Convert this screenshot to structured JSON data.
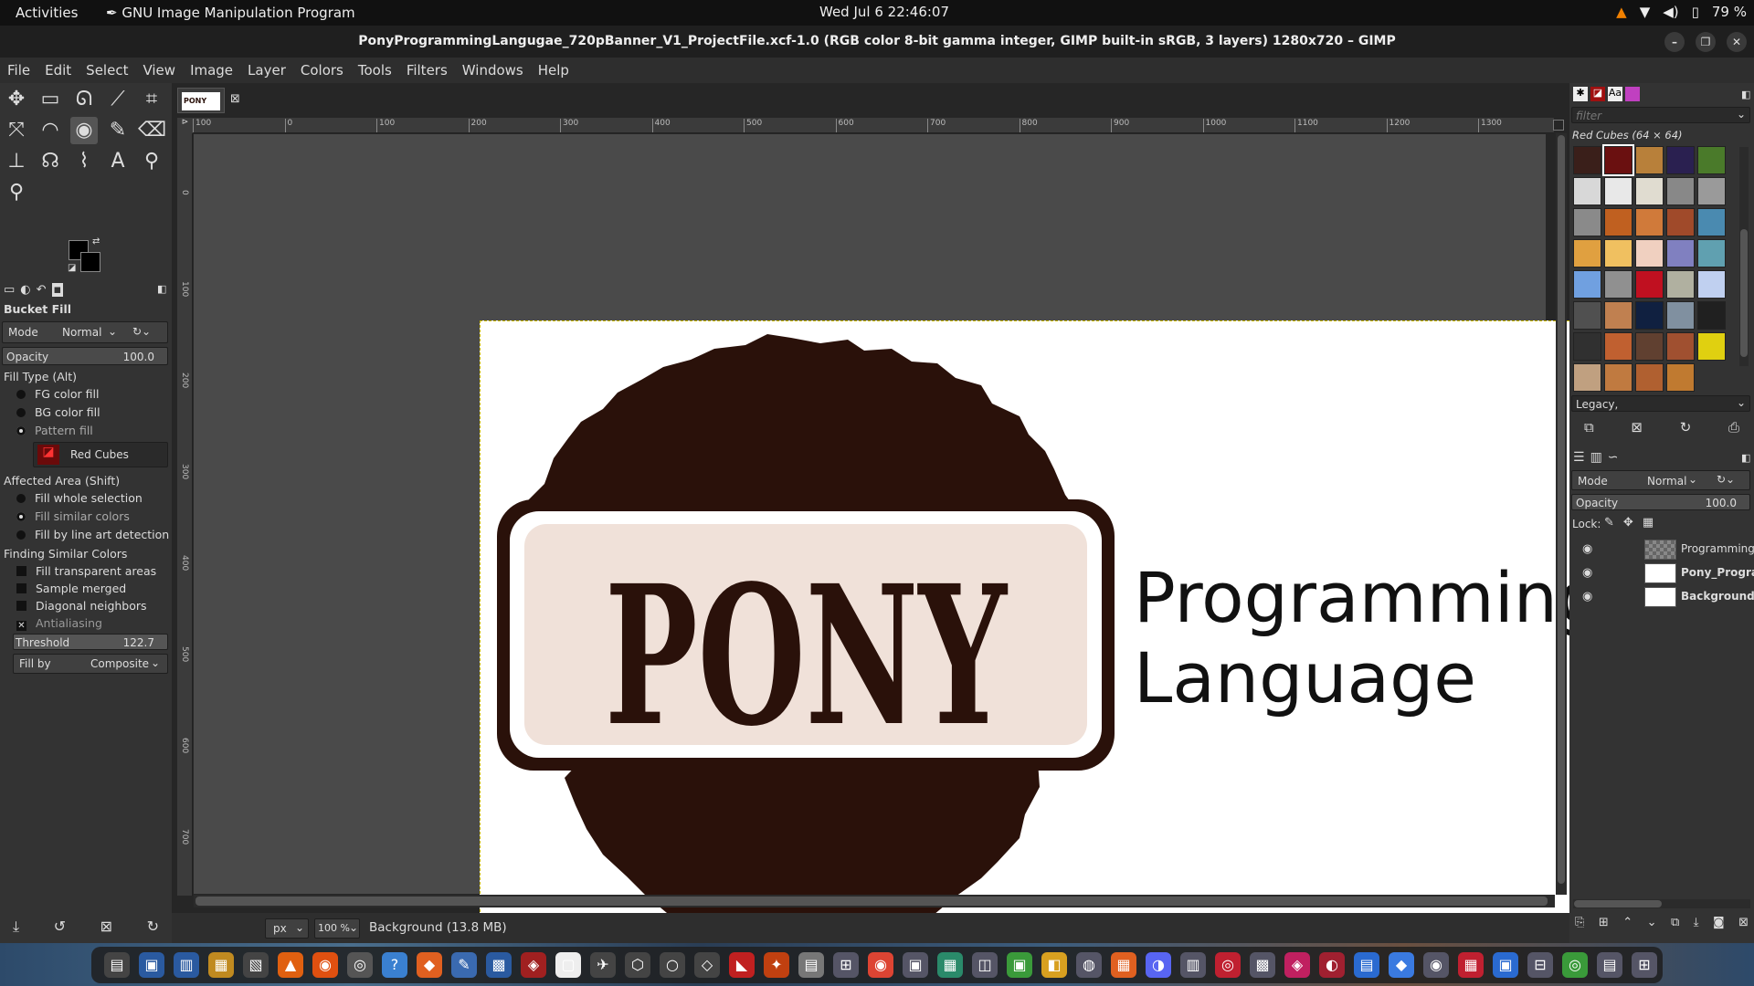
{
  "topbar": {
    "activities": "Activities",
    "app_name": "GNU Image Manipulation Program",
    "clock": "Wed Jul 6  22:46:07",
    "battery": "79 %"
  },
  "window": {
    "title": "PonyProgrammingLangugae_720pBanner_V1_ProjectFile.xcf-1.0 (RGB color 8-bit gamma integer, GIMP built-in sRGB, 3 layers) 1280x720 – GIMP"
  },
  "menu": [
    "File",
    "Edit",
    "Select",
    "View",
    "Image",
    "Layer",
    "Colors",
    "Tools",
    "Filters",
    "Windows",
    "Help"
  ],
  "toolbox": {
    "tools": [
      {
        "name": "move-tool-icon",
        "glyph": "✥"
      },
      {
        "name": "rect-select-icon",
        "glyph": "▭"
      },
      {
        "name": "free-select-icon",
        "glyph": "ᘏ"
      },
      {
        "name": "fuzzy-select-icon",
        "glyph": "⟋"
      },
      {
        "name": "crop-icon",
        "glyph": "⌗"
      },
      {
        "name": "unified-transform-icon",
        "glyph": "⤧"
      },
      {
        "name": "warp-transform-icon",
        "glyph": "◠"
      },
      {
        "name": "bucket-fill-icon",
        "glyph": "◉"
      },
      {
        "name": "paintbrush-icon",
        "glyph": "✎"
      },
      {
        "name": "eraser-icon",
        "glyph": "⌫"
      },
      {
        "name": "clone-icon",
        "glyph": "⊥"
      },
      {
        "name": "smudge-icon",
        "glyph": "☊"
      },
      {
        "name": "paths-icon",
        "glyph": "⌇"
      },
      {
        "name": "text-tool-icon",
        "glyph": "A"
      },
      {
        "name": "color-picker-icon",
        "glyph": "⚲"
      },
      {
        "name": "zoom-icon",
        "glyph": "⚲"
      }
    ]
  },
  "tool_options": {
    "title": "Bucket Fill",
    "mode_label": "Mode",
    "mode_value": "Normal",
    "opacity_label": "Opacity",
    "opacity_value": "100.0",
    "fill_type_label": "Fill Type  (Alt)",
    "fill_types": [
      "FG color fill",
      "BG color fill",
      "Pattern fill"
    ],
    "pattern_name": "Red Cubes",
    "affected_label": "Affected Area  (Shift)",
    "affected_options": [
      "Fill whole selection",
      "Fill similar colors",
      "Fill by line art detection"
    ],
    "similar_label": "Finding Similar Colors",
    "similar_options": [
      "Fill transparent areas",
      "Sample merged",
      "Diagonal neighbors",
      "Antialiasing"
    ],
    "threshold_label": "Threshold",
    "threshold_value": "122.7",
    "fillby_label": "Fill by",
    "fillby_value": "Composite"
  },
  "rulers": {
    "h_ticks": [
      "100",
      "0",
      "100",
      "200",
      "300",
      "400",
      "500",
      "600",
      "700",
      "800",
      "900",
      "1000",
      "1100",
      "1200",
      "1300"
    ],
    "v_ticks": [
      "0",
      "100",
      "200",
      "300",
      "400",
      "500",
      "600",
      "700"
    ]
  },
  "image": {
    "logo_word": "PONY",
    "line1": "Programming",
    "line2": "Language",
    "logo_color": "#2a110a",
    "plate_color": "#f0e1d9"
  },
  "status": {
    "unit": "px",
    "zoom": "100 %",
    "info": "Background (13.8 MB)"
  },
  "patterns": {
    "filter_placeholder": "filter",
    "title": "Red Cubes (64 × 64)",
    "tag": "Legacy,",
    "colors": [
      "#3a1f1a",
      "#6a1010",
      "#b8803a",
      "#2a2050",
      "#4a7a2a",
      "#d8d8d8",
      "#e8e8e8",
      "#e0dcd0",
      "#888888",
      "#9a9a9a",
      "#8a8a8a",
      "#c06020",
      "#d07a3a",
      "#a04a2a",
      "#4a8ab0",
      "#e0a040",
      "#f0c060",
      "#f0d0c0",
      "#8080c0",
      "#60a0b0",
      "#70a0e0",
      "#909090",
      "#c01020",
      "#b0b0a0",
      "#c0d0f0",
      "#505050",
      "#c08050",
      "#102040",
      "#8090a0",
      "#202020",
      "#303030",
      "#c06030",
      "#604030",
      "#a05030",
      "#e0d010",
      "#c0a080",
      "#c07a40",
      "#b06030",
      "#c07a30"
    ]
  },
  "layers": {
    "mode_label": "Mode",
    "mode_value": "Normal",
    "opacity_label": "Opacity",
    "opacity_value": "100.0",
    "lock_label": "Lock:",
    "items": [
      {
        "name": "Programming",
        "bold": false
      },
      {
        "name": "Pony_Program",
        "bold": true
      },
      {
        "name": "Background",
        "bold": true
      }
    ]
  },
  "dock_apps": [
    "▤",
    "▣",
    "▥",
    "▦",
    "▧",
    "▲",
    "◉",
    "◎",
    "?",
    "◆",
    "✎",
    "▩",
    "◈",
    "▢",
    "✈",
    "⬡",
    "○",
    "◇",
    "◣",
    "✦",
    "▤",
    "⊞",
    "◉",
    "▣",
    "▦",
    "◫",
    "▣",
    "◧",
    "◍",
    "▦",
    "◑",
    "▥",
    "◎",
    "▩",
    "◈",
    "◐",
    "▤",
    "◆",
    "◉",
    "▦",
    "▣",
    "⊟",
    "◎",
    "▤",
    "⊞"
  ]
}
